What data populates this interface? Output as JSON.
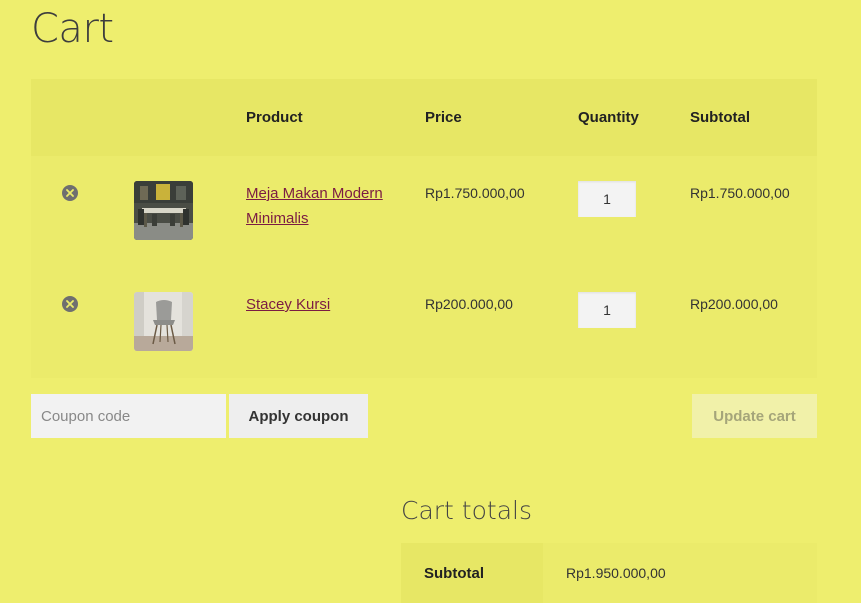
{
  "page": {
    "title": "Cart"
  },
  "table": {
    "headers": {
      "product": "Product",
      "price": "Price",
      "quantity": "Quantity",
      "subtotal": "Subtotal"
    },
    "items": [
      {
        "name": "Meja Makan Modern Minimalis",
        "price": "Rp1.750.000,00",
        "quantity": "1",
        "subtotal": "Rp1.750.000,00",
        "thumb_icon": "dining-table-photo"
      },
      {
        "name": "Stacey Kursi",
        "price": "Rp200.000,00",
        "quantity": "1",
        "subtotal": "Rp200.000,00",
        "thumb_icon": "chair-photo"
      }
    ]
  },
  "actions": {
    "coupon_placeholder": "Coupon code",
    "apply_label": "Apply coupon",
    "update_label": "Update cart"
  },
  "totals": {
    "title": "Cart totals",
    "subtotal_label": "Subtotal",
    "subtotal_value": "Rp1.950.000,00"
  },
  "colors": {
    "background": "#eeee6e",
    "link": "#7b1c43"
  }
}
